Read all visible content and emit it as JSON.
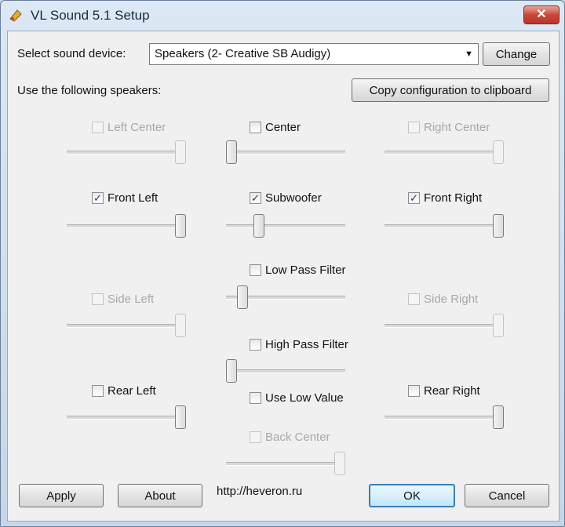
{
  "window": {
    "title": "VL Sound 5.1 Setup",
    "close_glyph": "✕",
    "icon": "app-icon"
  },
  "device": {
    "label": "Select sound device:",
    "value": "Speakers (2- Creative SB Audigy)",
    "arrow": "▼",
    "change_label": "Change"
  },
  "speakers_label": "Use the following speakers:",
  "copy_label": "Copy configuration to clipboard",
  "speakers": {
    "left_center": {
      "label": "Left Center",
      "checked": false,
      "enabled": false,
      "level": 1.0
    },
    "center": {
      "label": "Center",
      "checked": false,
      "enabled": true,
      "level": 0.0
    },
    "right_center": {
      "label": "Right Center",
      "checked": false,
      "enabled": false,
      "level": 1.0
    },
    "front_left": {
      "label": "Front Left",
      "checked": true,
      "enabled": true,
      "level": 1.0
    },
    "subwoofer": {
      "label": "Subwoofer",
      "checked": true,
      "enabled": true,
      "level": 0.25
    },
    "front_right": {
      "label": "Front Right",
      "checked": true,
      "enabled": true,
      "level": 1.0
    },
    "low_pass": {
      "label": "Low Pass Filter",
      "checked": false,
      "enabled": true,
      "level": 0.1
    },
    "side_left": {
      "label": "Side Left",
      "checked": false,
      "enabled": false,
      "level": 1.0
    },
    "side_right": {
      "label": "Side Right",
      "checked": false,
      "enabled": false,
      "level": 1.0
    },
    "high_pass": {
      "label": "High Pass Filter",
      "checked": false,
      "enabled": true,
      "level": 0.0
    },
    "rear_left": {
      "label": "Rear Left",
      "checked": false,
      "enabled": true,
      "level": 1.0
    },
    "use_low": {
      "label": "Use Low Value",
      "checked": false,
      "enabled": true
    },
    "rear_right": {
      "label": "Rear Right",
      "checked": false,
      "enabled": true,
      "level": 1.0
    },
    "back_center": {
      "label": "Back Center",
      "checked": false,
      "enabled": false,
      "level": 1.0
    }
  },
  "checkmark": "✓",
  "footer": {
    "apply_label": "Apply",
    "about_label": "About",
    "url": "http://heveron.ru",
    "ok_label": "OK",
    "cancel_label": "Cancel"
  }
}
